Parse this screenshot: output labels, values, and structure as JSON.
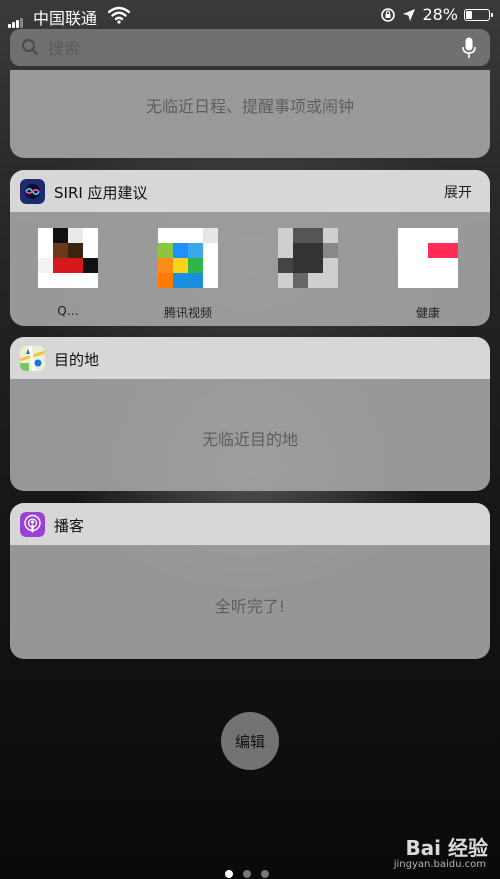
{
  "status_bar": {
    "carrier": "中国联通",
    "battery_percent": "28%",
    "battery_level": 0.28
  },
  "search": {
    "placeholder": "搜索"
  },
  "widgets": {
    "calendar": {
      "empty_text": "无临近日程、提醒事项或闹钟"
    },
    "siri": {
      "title": "SIRI 应用建议",
      "action": "展开",
      "apps": [
        {
          "label": "Q…"
        },
        {
          "label": "腾讯视频"
        },
        {
          "label": ""
        },
        {
          "label": "健康"
        }
      ]
    },
    "destinations": {
      "title": "目的地",
      "empty_text": "无临近目的地"
    },
    "podcasts": {
      "title": "播客",
      "empty_text": "全听完了!"
    }
  },
  "edit_button": {
    "label": "编辑"
  },
  "page_indicator": {
    "pages": 3,
    "current": 1
  },
  "watermark": {
    "text": "Bai 经验",
    "sub": "jingyan.baidu.com"
  },
  "colors": {
    "widget_bg": "#a8a8a8",
    "header_bg": "#dadada",
    "podcast_icon": "#9b3fd6",
    "siri_icon": "#1c2a6e"
  }
}
